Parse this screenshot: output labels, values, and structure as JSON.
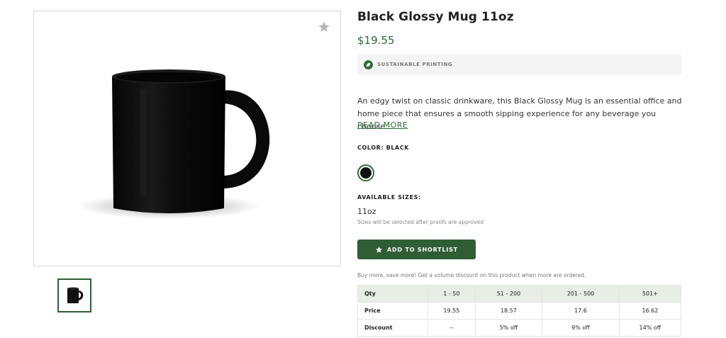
{
  "product": {
    "title": "Black Glossy Mug 11oz",
    "price": "$19.55",
    "badge": "SUSTAINABLE PRINTING",
    "description": "An edgy twist on classic drinkware, this Black Glossy Mug is an essential office and home piece that ensures a smooth sipping experience for any beverage you choose....",
    "read_more": "READ MORE",
    "color_label": "COLOR: BLACK",
    "color_swatch": "#111111",
    "sizes_label": "AVAILABLE SIZES:",
    "size_value": "11oz",
    "size_note": "Sizes will be selected after proofs are approved",
    "shortlist_button": "ADD TO SHORTLIST",
    "volume_note": "Buy more, save more! Get a volume discount on this product when more are ordered."
  },
  "gallery": {
    "favorite_icon": "star-icon",
    "thumbnail_icon": "mug-thumbnail"
  },
  "volume_table": {
    "headers": [
      "Qty",
      "1 - 50",
      "51 - 200",
      "201 - 500",
      "501+"
    ],
    "price_row": [
      "Price",
      "19.55",
      "18.57",
      "17.6",
      "16.62"
    ],
    "discount_row": [
      "Discount",
      "--",
      "5% off",
      "9% off",
      "14% off"
    ]
  },
  "colors": {
    "brand_green": "#2f5e35",
    "price_green": "#2f6b3a",
    "table_header_bg": "#e8ede6"
  }
}
